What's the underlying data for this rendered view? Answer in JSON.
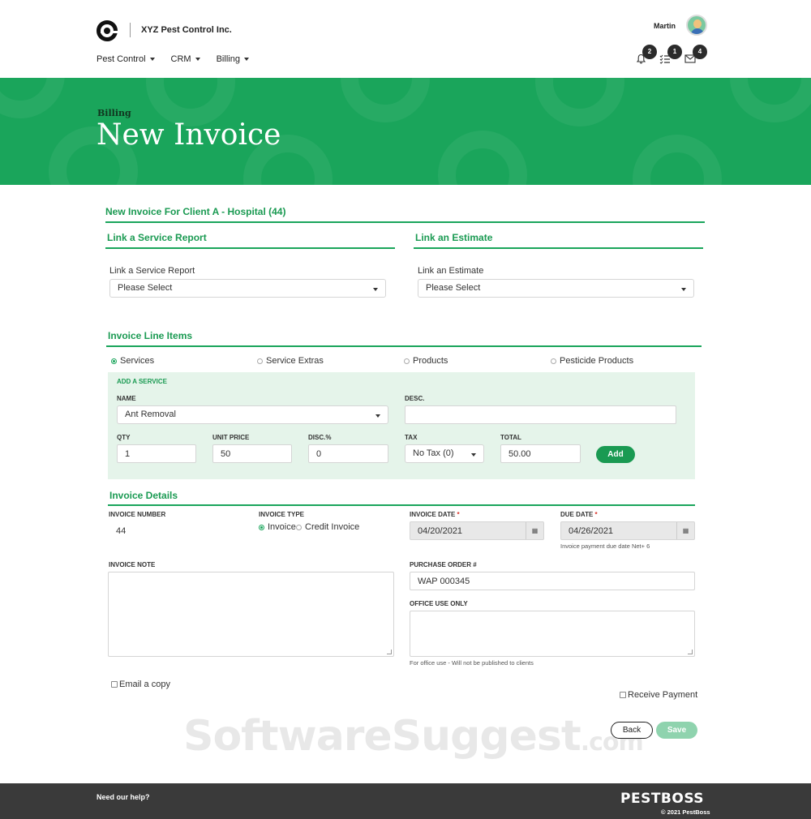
{
  "header": {
    "company": "XYZ Pest Control Inc.",
    "user": "Martin",
    "nav": [
      "Pest Control",
      "CRM",
      "Billing"
    ],
    "notifications": {
      "bell": "2",
      "tasks": "1",
      "mail": "4"
    }
  },
  "banner": {
    "breadcrumb": "Billing",
    "title": "New Invoice"
  },
  "invoice_for": "New Invoice For Client A - Hospital (44)",
  "service_report": {
    "section_title": "Link a Service Report",
    "label": "Link a Service Report",
    "value": "Please Select"
  },
  "estimate": {
    "section_title": "Link an Estimate",
    "label": "Link an Estimate",
    "value": "Please Select"
  },
  "line_items": {
    "title": "Invoice Line Items",
    "types": [
      "Services",
      "Service Extras",
      "Products",
      "Pesticide Products"
    ],
    "selected_type": "Services",
    "add_service": {
      "heading": "ADD A SERVICE",
      "name_label": "NAME",
      "name_value": "Ant Removal",
      "desc_label": "DESC.",
      "desc_value": "",
      "qty_label": "QTY",
      "qty_value": "1",
      "unit_price_label": "UNIT PRICE",
      "unit_price_value": "50",
      "disc_label": "DISC.%",
      "disc_value": "0",
      "tax_label": "TAX",
      "tax_value": "No Tax (0)",
      "total_label": "TOTAL",
      "total_value": "50.00",
      "add_button": "Add"
    }
  },
  "details": {
    "title": "Invoice Details",
    "number_label": "INVOICE NUMBER",
    "number_value": "44",
    "type_label": "INVOICE TYPE",
    "type_options": [
      "Invoice",
      "Credit Invoice"
    ],
    "type_selected": "Invoice",
    "date_label": "INVOICE DATE",
    "date_value": "04/20/2021",
    "due_label": "DUE DATE",
    "due_value": "04/26/2021",
    "due_hint": "Invoice payment due date Net+ 6",
    "required_mark": "*",
    "note_label": "INVOICE NOTE",
    "po_label": "PURCHASE ORDER #",
    "po_value": "WAP 000345",
    "office_label": "OFFICE USE ONLY",
    "office_hint": "For office use - Will not be published to clients"
  },
  "options": {
    "email_copy": "Email a copy",
    "receive_payment": "Receive Payment"
  },
  "actions": {
    "back": "Back",
    "save": "Save"
  },
  "watermark": {
    "main": "SoftwareSuggest",
    "suffix": ".com"
  },
  "footer": {
    "help": "Need our help?",
    "brand": "PESTBOSS",
    "copyright": "© 2021 PestBoss"
  },
  "colors": {
    "brand_green": "#1aa55b",
    "panel_green": "#e5f4ea",
    "footer": "#3a3a3a"
  }
}
